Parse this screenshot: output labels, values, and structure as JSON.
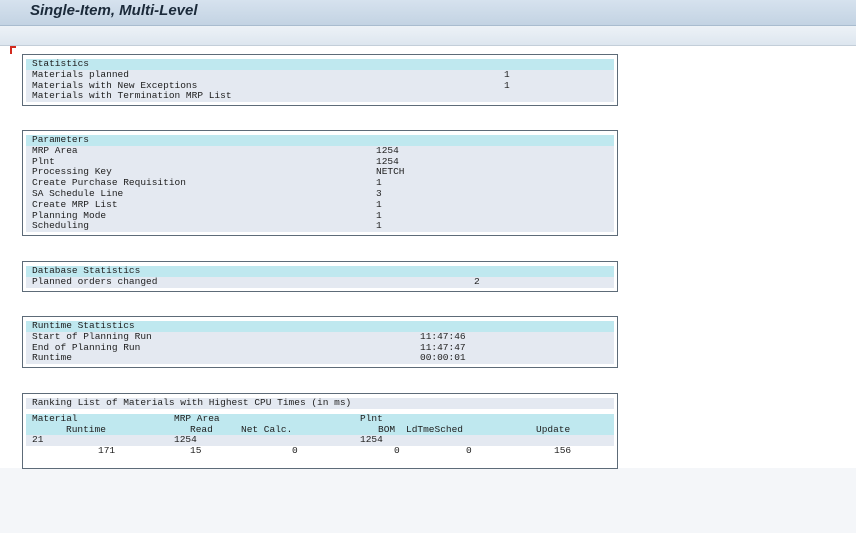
{
  "window": {
    "title": "Single-Item, Multi-Level"
  },
  "statistics": {
    "header": "Statistics",
    "rows": [
      {
        "label": "Materials planned",
        "value": "1"
      },
      {
        "label": "Materials with New Exceptions",
        "value": "1"
      },
      {
        "label": "Materials with Termination MRP List",
        "value": ""
      }
    ]
  },
  "parameters": {
    "header": "Parameters",
    "rows": [
      {
        "label": "MRP Area",
        "value": "1254"
      },
      {
        "label": "Plnt",
        "value": "1254"
      },
      {
        "label": "Processing Key",
        "value": "NETCH"
      },
      {
        "label": "Create Purchase Requisition",
        "value": "1"
      },
      {
        "label": "SA Schedule Line",
        "value": "3"
      },
      {
        "label": "Create MRP List",
        "value": "1"
      },
      {
        "label": "Planning Mode",
        "value": "1"
      },
      {
        "label": "Scheduling",
        "value": "1"
      }
    ]
  },
  "database_statistics": {
    "header": "Database Statistics",
    "rows": [
      {
        "label": "Planned orders changed",
        "value": "2"
      }
    ]
  },
  "runtime_statistics": {
    "header": "Runtime Statistics",
    "rows": [
      {
        "label": "Start of Planning Run",
        "value": "11:47:46"
      },
      {
        "label": "End of Planning Run",
        "value": "11:47:47"
      },
      {
        "label": "Runtime",
        "value": "00:00:01"
      }
    ]
  },
  "ranking": {
    "header": "Ranking List of Materials with Highest CPU Times (in ms)",
    "col_header_1": {
      "material": "Material",
      "mrp_area": "MRP Area",
      "plnt": "Plnt"
    },
    "col_header_2": {
      "runtime": "Runtime",
      "read": "Read",
      "net_calc": "Net Calc.",
      "bom": "BOM",
      "ldtmesched": "LdTmeSched",
      "update": "Update"
    },
    "rows": [
      {
        "line1": {
          "material": "21",
          "mrp_area": "1254",
          "plnt": "1254"
        },
        "line2": {
          "runtime": "171",
          "read": "15",
          "net_calc": "0",
          "bom": "0",
          "ldtmesched": "0",
          "update": "156"
        }
      }
    ]
  }
}
